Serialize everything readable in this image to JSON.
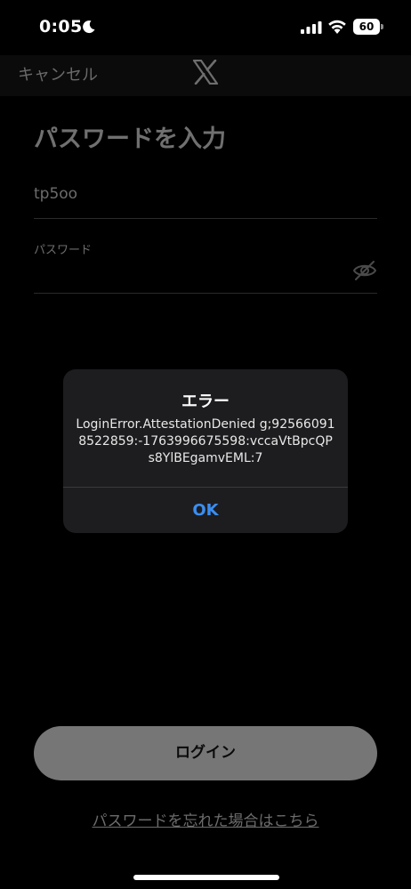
{
  "status_bar": {
    "time": "0:05",
    "battery_level": "60",
    "icons": [
      "moon-icon",
      "signal-icon",
      "wifi-icon",
      "battery-icon"
    ]
  },
  "nav": {
    "cancel_label": "キャンセル",
    "logo": "x-logo"
  },
  "form": {
    "title": "パスワードを入力",
    "username_value": "tp5oo",
    "password_label": "パスワード",
    "visibility_icon": "eye-off-icon"
  },
  "alert": {
    "title": "エラー",
    "message": "LoginError.AttestationDenied g;925660918522859:-1763996675598:vccaVtBpcQPs8YlBEgamvEML:7",
    "ok_label": "OK"
  },
  "bottom": {
    "login_label": "ログイン",
    "forgot_label": "パスワードを忘れた場合はこちら"
  },
  "colors": {
    "accent": "#3a8ef0",
    "alert_bg": "#1d1d1f",
    "button_bg": "#767676"
  }
}
